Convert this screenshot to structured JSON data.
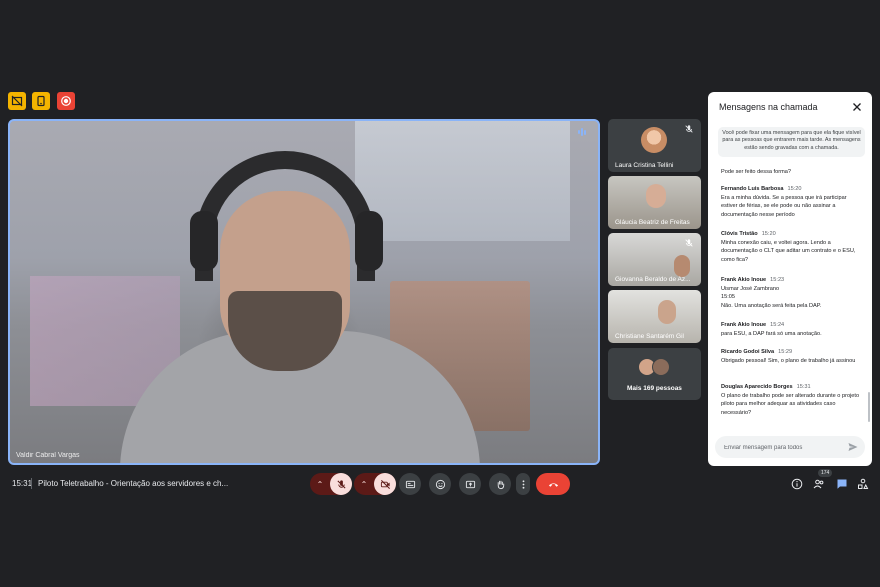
{
  "colors": {
    "accent": "#8ab4f8",
    "chip_yellow": "#f4b400",
    "chip_red": "#ea4335",
    "end_call": "#ea4335",
    "mic_off_bg": "#f9dedc"
  },
  "status_chips": [
    {
      "icon": "no-captions-icon"
    },
    {
      "icon": "companion-icon"
    },
    {
      "icon": "recording-icon"
    }
  ],
  "main_video": {
    "participant_name": "Valdir Cabral Vargas"
  },
  "participants": [
    {
      "name": "Laura Cristina Tellini",
      "muted": true,
      "camera": false
    },
    {
      "name": "Gláucia Beatriz de Freitas",
      "muted": false,
      "camera": true
    },
    {
      "name": "Giovanna Beraldo de Az...",
      "muted": true,
      "camera": true
    },
    {
      "name": "Christiane Santarém Gil",
      "muted": false,
      "camera": true
    }
  ],
  "more_people": {
    "label": "Mais 169 pessoas"
  },
  "chat": {
    "title": "Mensagens na chamada",
    "notice": "Você pode fixar uma mensagem para que ela fique visível para as pessoas que entrarem mais tarde. As mensagens estão sendo gravadas com a chamada.",
    "messages": [
      {
        "author": "",
        "time": "",
        "text": "Pode ser feito dessa forma?"
      },
      {
        "author": "Fernando Luis Barbosa",
        "time": "15:20",
        "text": "Era a minha dúvida. Se a pessoa que irá participar estiver de férias, se ele pode ou não assinar a documentação nesse período"
      },
      {
        "author": "Clóvis Tristão",
        "time": "15:20",
        "text": "Minha conexão caiu, e voltei agora. Lendo a documentação o CLT que aditar um contrato e o ESU, como fica?"
      },
      {
        "author": "Frank Akio Inoue",
        "time": "15:23",
        "text": "Uismar José Zambrano"
      },
      {
        "author": "",
        "time": "",
        "text": "15:05"
      },
      {
        "author": "",
        "time": "",
        "text": "Não. Uma anotação será feita pela DAP."
      },
      {
        "author": "Frank Akio Inoue",
        "time": "15:24",
        "text": "para ESU, a DAP fará só uma anotação."
      },
      {
        "author": "Ricardo Godoi Silva",
        "time": "15:29",
        "text": "Obrigado pessoal! Sim, o plano de trabalho já assinou"
      },
      {
        "author": "Douglas Aparecido Borges",
        "time": "15:31",
        "text": "O plano de trabalho pode ser alterado durante o projeto piloto para melhor adequar as atividades caso necessário?"
      }
    ],
    "input_placeholder": "Enviar mensagem para todos"
  },
  "bottom_bar": {
    "time": "15:31",
    "meeting_title": "Piloto Teletrabalho - Orientação aos servidores e ch...",
    "people_count": "174"
  }
}
